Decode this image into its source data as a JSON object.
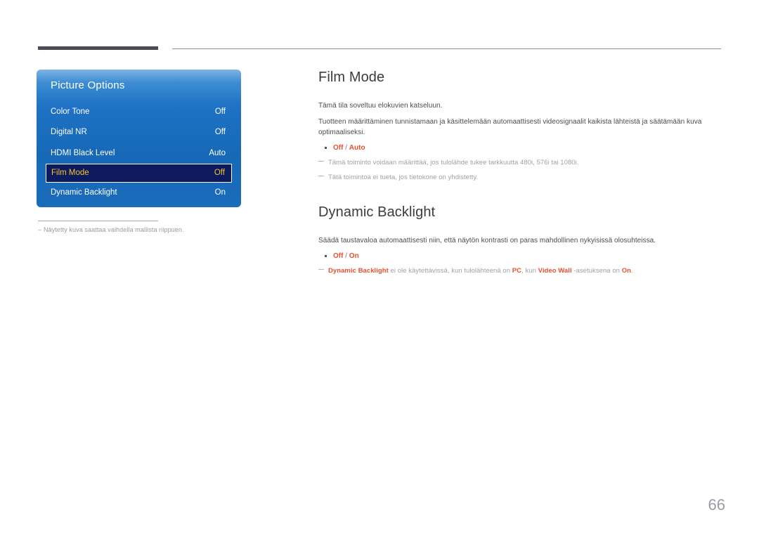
{
  "header": {
    "rule_thick_color": "#4a4a58",
    "rule_thin_color": "#8b8b92"
  },
  "osd": {
    "title": "Picture Options",
    "selected_index": 3,
    "rows": [
      {
        "label": "Color Tone",
        "value": "Off"
      },
      {
        "label": "Digital NR",
        "value": "Off"
      },
      {
        "label": "HDMI Black Level",
        "value": "Auto"
      },
      {
        "label": "Film Mode",
        "value": "Off"
      },
      {
        "label": "Dynamic Backlight",
        "value": "On"
      }
    ],
    "footnote_dash": "–",
    "footnote": "Näytetty kuva saattaa vaihdella mallista riippuen."
  },
  "sections": [
    {
      "title": "Film Mode",
      "paragraphs": [
        "Tämä tila soveltuu elokuvien katseluun.",
        "Tuotteen määrittäminen tunnistamaan ja käsittelemään automaattisesti videosignaalit kaikista lähteistä ja säätämään kuva optimaaliseksi."
      ],
      "options": [
        {
          "opt1": "Off",
          "slash": " / ",
          "opt2": "Auto"
        }
      ],
      "notes": [
        {
          "parts": [
            {
              "text": "Tämä toiminto voidaan määrittää, jos tulolähde tukee tarkkuutta 480i, 576i tai 1080i.",
              "accent": false
            }
          ]
        },
        {
          "parts": [
            {
              "text": "Tätä toimintoa ei tueta, jos tietokone on yhdistetty.",
              "accent": false
            }
          ]
        }
      ]
    },
    {
      "title": "Dynamic Backlight",
      "paragraphs": [
        "Säädä taustavaloa automaattisesti niin, että näytön kontrasti on paras mahdollinen nykyisissä olosuhteissa."
      ],
      "options": [
        {
          "opt1": "Off",
          "slash": " / ",
          "opt2": "On"
        }
      ],
      "notes": [
        {
          "parts": [
            {
              "text": "Dynamic Backlight",
              "accent": true
            },
            {
              "text": " ei ole käytettävissä, kun tulolähteenä on ",
              "accent": false
            },
            {
              "text": "PC",
              "accent": true
            },
            {
              "text": ", kun ",
              "accent": false
            },
            {
              "text": "Video Wall",
              "accent": true
            },
            {
              "text": " -asetuksena on ",
              "accent": false
            },
            {
              "text": "On",
              "accent": true
            },
            {
              "text": ".",
              "accent": false
            }
          ]
        }
      ]
    }
  ],
  "page_number": "66",
  "colors": {
    "accent": "#e8502f",
    "osd_blue": "#1f72c4",
    "osd_selected_bg": "#0d1b5e",
    "osd_selected_text": "#f2c430",
    "heading": "#3b3b41",
    "body": "#4b4b51",
    "note": "#a0a0a6",
    "page_number": "#9b9ba6"
  }
}
